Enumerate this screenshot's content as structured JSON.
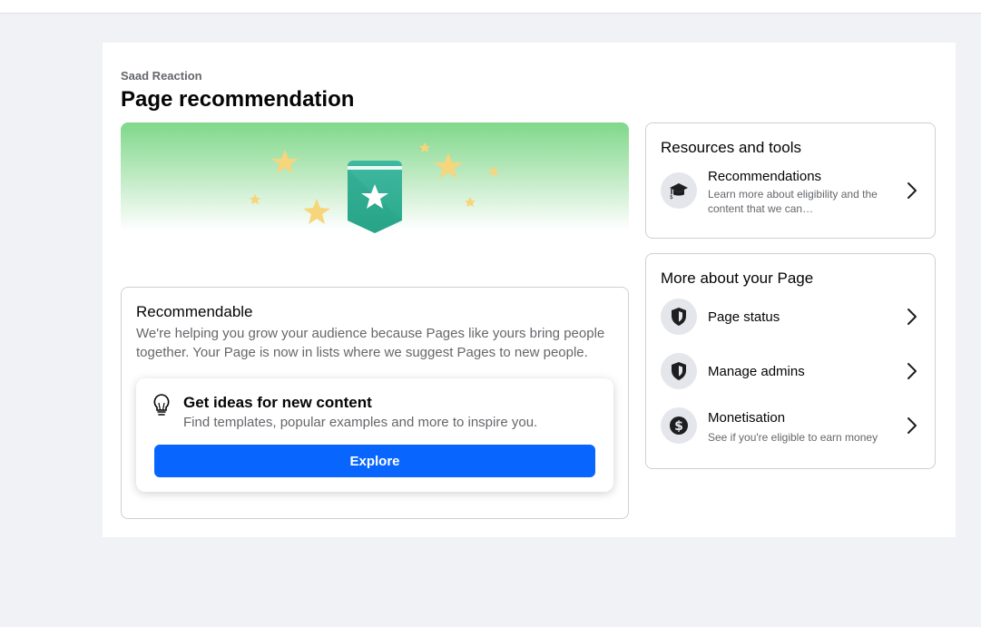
{
  "header": {
    "page_name": "Saad Reaction",
    "title": "Page recommendation"
  },
  "recommendable": {
    "title": "Recommendable",
    "description": "We're helping you grow your audience because Pages like yours bring people together. Your Page is now in lists where we suggest Pages to new people."
  },
  "ideas": {
    "title": "Get ideas for new content",
    "description": "Find templates, popular examples and more to inspire you.",
    "button_label": "Explore"
  },
  "resources": {
    "title": "Resources and tools",
    "items": [
      {
        "label": "Recommendations",
        "description": "Learn more about eligibility and the content that we can…",
        "icon": "graduation-cap-icon"
      }
    ]
  },
  "more_about": {
    "title": "More about your Page",
    "items": [
      {
        "label": "Page status",
        "icon": "shield-icon"
      },
      {
        "label": "Manage admins",
        "icon": "shield-icon"
      },
      {
        "label": "Monetisation",
        "description": "See if you're eligible to earn money",
        "icon": "dollar-icon"
      }
    ]
  },
  "colors": {
    "primary_button": "#0866ff",
    "hero_green": "#7fd88a",
    "badge_teal": "#2fb19a",
    "star_yellow": "#f7d57a",
    "secondary_text": "#65676b"
  }
}
